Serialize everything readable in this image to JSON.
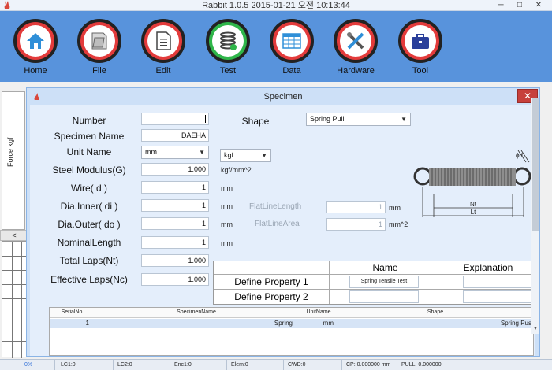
{
  "window": {
    "title": "Rabbit 1.0.5 2015-01-21 오전 10:13:44",
    "min_glyph": "─",
    "max_glyph": "□",
    "close_glyph": "✕"
  },
  "toolbar": {
    "items": [
      {
        "label": "Home",
        "icon": "house-icon",
        "ring": "#e33b3b"
      },
      {
        "label": "File",
        "icon": "folder-icon",
        "ring": "#e33b3b"
      },
      {
        "label": "Edit",
        "icon": "document-icon",
        "ring": "#e33b3b"
      },
      {
        "label": "Test",
        "icon": "spring-icon",
        "ring": "#2fb64a"
      },
      {
        "label": "Data",
        "icon": "table-icon",
        "ring": "#e33b3b"
      },
      {
        "label": "Hardware",
        "icon": "tools-icon",
        "ring": "#e33b3b"
      },
      {
        "label": "Tool",
        "icon": "toolbox-icon",
        "ring": "#e33b3b"
      }
    ]
  },
  "background": {
    "force_axis_label": "Force kgf",
    "scroll_left_glyph": "<"
  },
  "dialog": {
    "title": "Specimen",
    "close_glyph": "✕",
    "fields": {
      "number_label": "Number",
      "number_value": "",
      "shape_label": "Shape",
      "shape_value": "Spring Pull",
      "specimen_name_label": "Specimen Name",
      "specimen_name_value": "DAEHA",
      "unit_name_label": "Unit Name",
      "length_unit_value": "mm",
      "force_unit_value": "kgf",
      "steel_modulus_label": "Steel Modulus(G)",
      "steel_modulus_value": "1.000",
      "steel_modulus_unit": "kgf/mm^2",
      "wire_label": "Wire( d )",
      "wire_value": "1",
      "wire_unit": "mm",
      "dia_inner_label": "Dia.Inner( di )",
      "dia_inner_value": "1",
      "dia_inner_unit": "mm",
      "dia_outer_label": "Dia.Outer( do )",
      "dia_outer_value": "1",
      "dia_outer_unit": "mm",
      "nominal_length_label": "NominalLength",
      "nominal_length_value": "1",
      "nominal_length_unit": "mm",
      "total_laps_label": "Total Laps(Nt)",
      "total_laps_value": "1.000",
      "effective_laps_label": "Effective Laps(Nc)",
      "effective_laps_value": "1.000",
      "flat_line_length_label": "FlatLineLength",
      "flat_line_length_value": "1",
      "flat_line_length_unit": "mm",
      "flat_line_area_label": "FlatLineArea",
      "flat_line_area_value": "1",
      "flat_line_area_unit": "mm^2"
    },
    "diagram": {
      "label_nt": "Nt",
      "label_lt": "Lt",
      "label_phi": "ϕd"
    },
    "property_table": {
      "header_name": "Name",
      "header_explanation": "Explanation",
      "rows": [
        {
          "label": "Define Property 1",
          "name": "Spring Tensile Test",
          "explanation": ""
        },
        {
          "label": "Define Property 2",
          "name": "",
          "explanation": ""
        }
      ]
    },
    "list": {
      "headers": [
        "SerialNo",
        "SpecimenName",
        "UnitName",
        "Shape"
      ],
      "row": {
        "serial": "1",
        "name": "Spring",
        "unit": "mm",
        "shape": "Spring Pus"
      }
    }
  },
  "statusbar": {
    "progress": "0%",
    "cells": [
      "LC1:0",
      "LC2:0",
      "Enc1:0",
      "Elem:0",
      "CWD:0",
      "CP: 0.000000 mm",
      "PULL: 0.000000"
    ]
  }
}
